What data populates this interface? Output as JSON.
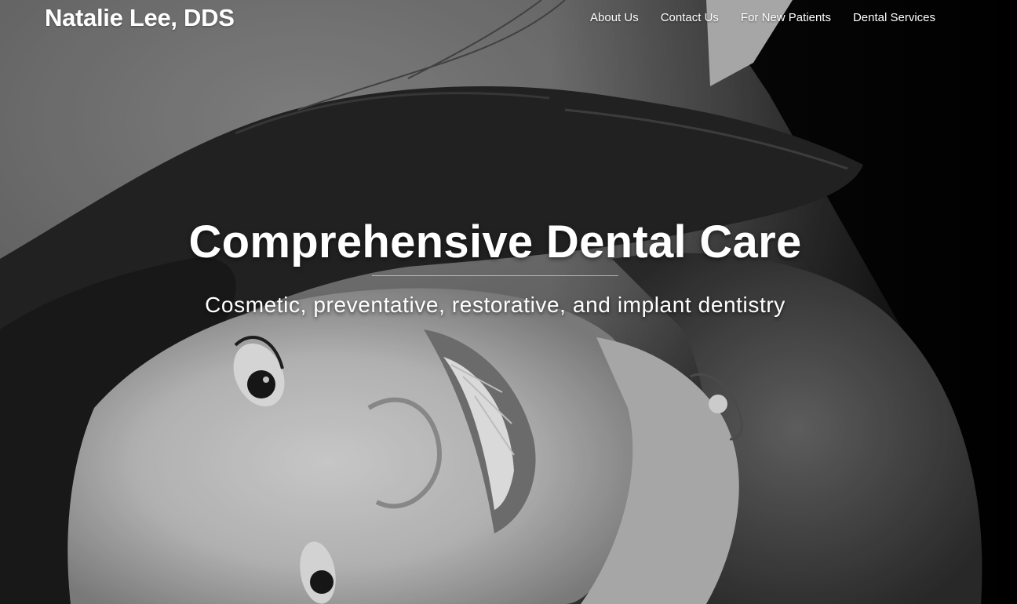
{
  "header": {
    "brand": "Natalie Lee, DDS",
    "nav": [
      {
        "label": "About Us"
      },
      {
        "label": "Contact Us"
      },
      {
        "label": "For New Patients"
      },
      {
        "label": "Dental Services"
      }
    ]
  },
  "hero": {
    "title": "Comprehensive Dental Care",
    "subtitle": "Cosmetic, preventative, restorative, and implant dentistry",
    "background": "black-and-white photo of smiling woman lying on carpet"
  },
  "colors": {
    "text": "#ffffff",
    "background": "#000000"
  }
}
